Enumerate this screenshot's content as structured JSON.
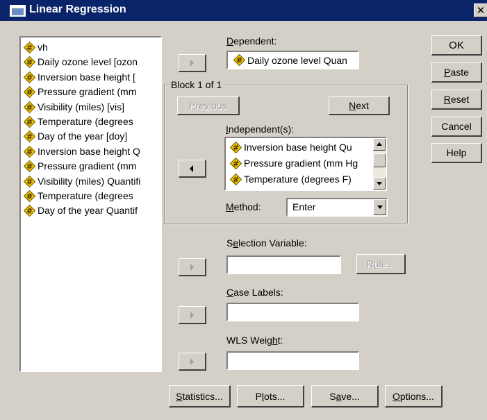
{
  "window": {
    "title": "Linear Regression",
    "close_glyph": "✕"
  },
  "source_variables": [
    {
      "label": "vh",
      "icon": "scale-variable-icon"
    },
    {
      "label": "Daily ozone level [ozon",
      "icon": "scale-variable-icon"
    },
    {
      "label": "Inversion base height [",
      "icon": "scale-variable-icon"
    },
    {
      "label": "Pressure gradient (mm",
      "icon": "scale-variable-icon"
    },
    {
      "label": "Visibility (miles) [vis]",
      "icon": "scale-variable-icon"
    },
    {
      "label": "Temperature (degrees",
      "icon": "scale-variable-icon"
    },
    {
      "label": "Day of the year [doy]",
      "icon": "scale-variable-icon"
    },
    {
      "label": "Inversion base height Q",
      "icon": "scale-variable-icon"
    },
    {
      "label": "Pressure gradient (mm",
      "icon": "scale-variable-icon"
    },
    {
      "label": "Visibility (miles) Quantifi",
      "icon": "scale-variable-icon"
    },
    {
      "label": "Temperature (degrees",
      "icon": "scale-variable-icon"
    },
    {
      "label": "Day of the year Quantif",
      "icon": "scale-variable-icon"
    }
  ],
  "dependent": {
    "label": "Dependent:",
    "value": "Daily ozone level Quan"
  },
  "block": {
    "title": "Block 1 of 1",
    "previous_label": "Previous",
    "next_label": "Next"
  },
  "independents": {
    "label": "Independent(s):",
    "items": [
      "Inversion base height Qu",
      "Pressure gradient (mm Hg",
      "Temperature (degrees F)"
    ]
  },
  "method": {
    "label": "Method:",
    "value": "Enter"
  },
  "selection_variable": {
    "label": "Selection Variable:",
    "value": "",
    "rule_label": "Rule..."
  },
  "case_labels": {
    "label": "Case Labels:",
    "value": ""
  },
  "wls_weight": {
    "label": "WLS Weight:",
    "value": ""
  },
  "side_buttons": {
    "ok": "OK",
    "paste": "Paste",
    "reset": "Reset",
    "cancel": "Cancel",
    "help": "Help"
  },
  "bottom_buttons": {
    "statistics": "Statistics...",
    "plots": "Plots...",
    "save": "Save...",
    "options": "Options..."
  },
  "colors": {
    "titlebar": "#0a246a",
    "face": "#d4d0c8",
    "variable_icon": "#f2c400"
  }
}
